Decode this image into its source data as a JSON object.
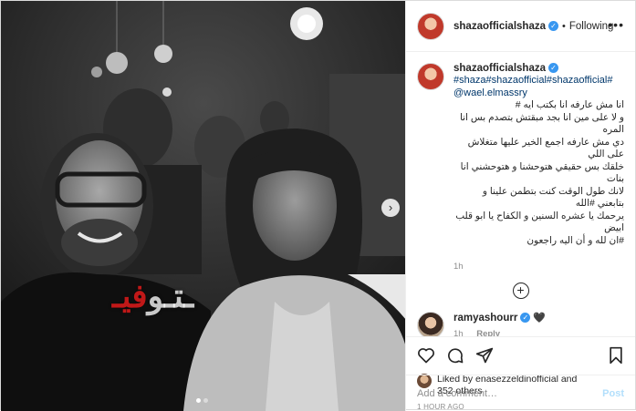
{
  "photo": {
    "watermark_part1": "فيـ",
    "watermark_part2": "ـتـو",
    "carousel_count": 2,
    "carousel_active": 1
  },
  "header": {
    "username": "shazaofficialshaza",
    "follow_status": "Following",
    "more_icon": "ellipsis-icon"
  },
  "caption": {
    "username": "shazaofficialshaza",
    "hashtags": "#shaza#shazaofficial#shazaofficial#",
    "mention": "@wael.elmassry",
    "text_lines": [
      "انا مش عارفه انا بكتب ايه #",
      "و لا على مين انا بجد مبقتش بتصدم بس انا المره",
      "دي مش عارفه اجمع الخير عليها متغلاش على اللي",
      "خلقك بس حقيقي هتوحشنا و هتوحشني انا بنات",
      "لانك طول الوقت كنت بتطمن علينا و بتابعني #الله",
      "يرحمك يا عشره السنين و الكفاح يا ابو قلب ابيض",
      "#ان لله و أن اليه راجعون"
    ],
    "age": "1h"
  },
  "comments": [
    {
      "username": "ramyashourr",
      "text": "🖤",
      "age": "1h",
      "reply_label": "Reply"
    }
  ],
  "likes": {
    "prefix": "Liked by ",
    "first_liker": "enasezzeldinofficial",
    "connector": " and",
    "others": "352 others"
  },
  "timestamp": "1 HOUR AGO",
  "add_comment": {
    "placeholder": "Add a comment…",
    "post_label": "Post"
  },
  "colors": {
    "link": "#00376b",
    "verified": "#3897f0",
    "muted": "#8e8e8e",
    "post_disabled": "#b2dffc"
  }
}
